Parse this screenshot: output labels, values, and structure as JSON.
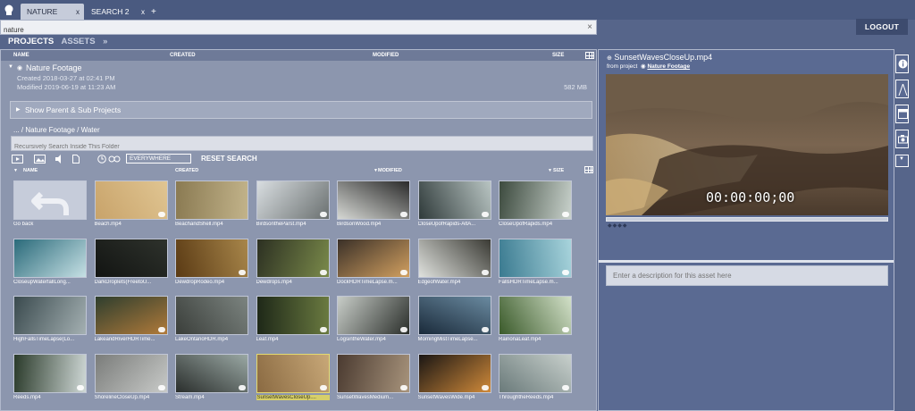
{
  "tabs": [
    {
      "label": "NATURE",
      "close": "x"
    },
    {
      "label": "SEARCH 2",
      "close": "x"
    }
  ],
  "tab_add": "+",
  "search": {
    "value": "nature",
    "clear": "×"
  },
  "logout_label": "LOGOUT",
  "section_nav": {
    "projects": "PROJECTS",
    "assets": "ASSETS",
    "chevron": "»"
  },
  "columns": {
    "name": "NAME",
    "created": "CREATED",
    "modified": "MODIFIED",
    "size": "SIZE"
  },
  "project": {
    "title": "Nature Footage",
    "created": "Created  2018-03-27 at 02:41 PM",
    "modified": "Modified 2019-06-19 at 11:23 AM",
    "size": "582 MB"
  },
  "show_sub_label": "Show Parent & Sub Projects",
  "path": "... / Nature Footage  / Water",
  "sub_search_placeholder": "Recursively Search Inside This Folder",
  "toolbar": {
    "scope": "EVERYWHERE",
    "reset": "RESET SEARCH"
  },
  "thumbnails": [
    "Go back",
    "Beach.mp4",
    "BeachandShell.mp4",
    "BirdsontheParst.mp4",
    "BirdsonWood.mp4",
    "CloseUpofRapids-AltA...",
    "CloseUpofRapids.mp4",
    "CloseupWaterfallLong...",
    "DarkDroplets(FreetoU...",
    "DewdropRodeo.mp4",
    "Dewdrops.mp4",
    "DockHDRTimeLapse.m...",
    "EdgeofWater.mp4",
    "FallsHDRTimeLapse.m...",
    "HighFallsTimeLapse(Lo...",
    "LakeandRiverHDRTime...",
    "LakeOntarioHDR.mp4",
    "Leaf.mp4",
    "LogsintheWater.mp4",
    "MorningMistTimeLapse...",
    "RainonaLeaf.mp4",
    "Reeds.mp4",
    "ShorelineCloseUp.mp4",
    "Stream.mp4",
    "SunsetWavesCloseUp....",
    "SunsetWavesMedium...",
    "SunsetWavesWide.mp4",
    "ThroughtheReeds.mp4"
  ],
  "asset": {
    "title": "SunsetWavesCloseUp.mp4",
    "from_label": "from project",
    "project_link": "Nature Footage",
    "timecode": "00:00:00;00",
    "markers": "◆◆◆◆",
    "description_placeholder": "Enter a description for this asset here"
  },
  "side_icons": [
    "info-icon",
    "compass-icon",
    "panel-icon",
    "camera-icon",
    "dropdown-icon"
  ]
}
